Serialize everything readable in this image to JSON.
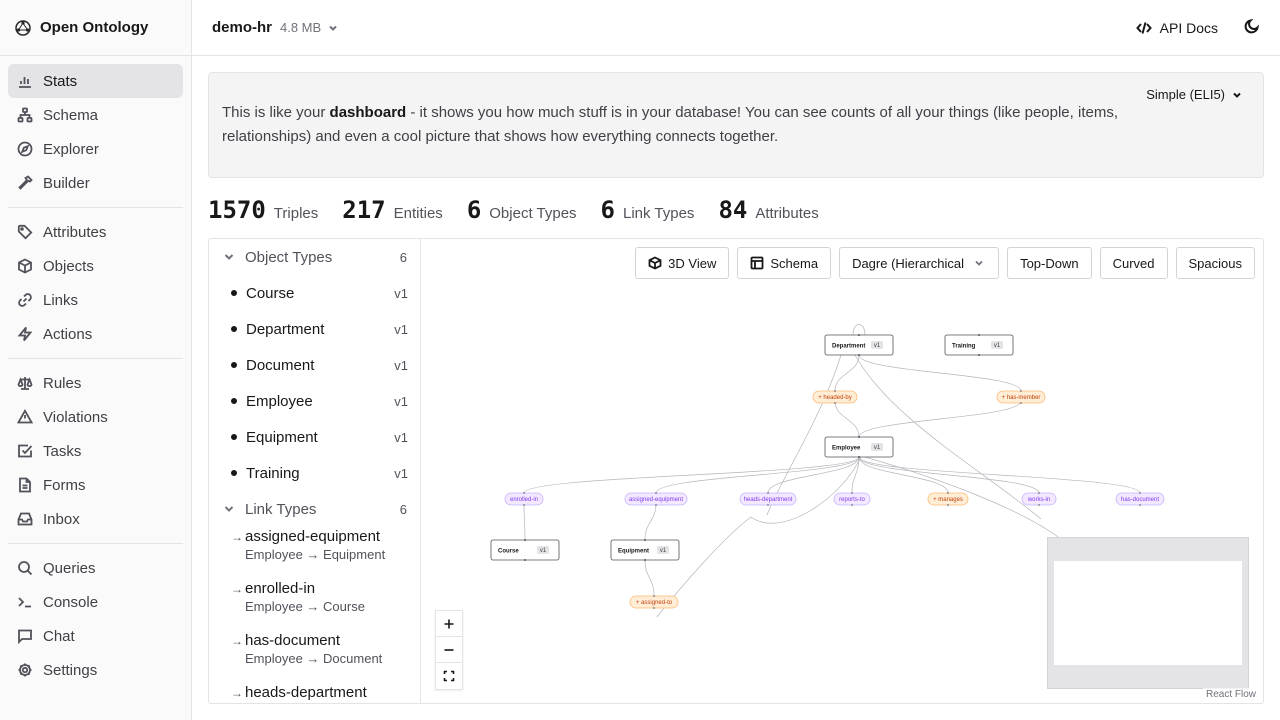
{
  "app": {
    "title": "Open Ontology"
  },
  "sidebar": {
    "groups": [
      [
        {
          "label": "Stats",
          "icon": "bar-chart-icon",
          "active": true
        },
        {
          "label": "Schema",
          "icon": "network-icon"
        },
        {
          "label": "Explorer",
          "icon": "compass-icon"
        },
        {
          "label": "Builder",
          "icon": "hammer-icon"
        }
      ],
      [
        {
          "label": "Attributes",
          "icon": "tag-icon"
        },
        {
          "label": "Objects",
          "icon": "box-icon"
        },
        {
          "label": "Links",
          "icon": "link-icon"
        },
        {
          "label": "Actions",
          "icon": "zap-icon"
        }
      ],
      [
        {
          "label": "Rules",
          "icon": "scale-icon"
        },
        {
          "label": "Violations",
          "icon": "alert-triangle-icon"
        },
        {
          "label": "Tasks",
          "icon": "check-square-icon"
        },
        {
          "label": "Forms",
          "icon": "file-text-icon"
        },
        {
          "label": "Inbox",
          "icon": "inbox-icon"
        }
      ],
      [
        {
          "label": "Queries",
          "icon": "search-icon"
        },
        {
          "label": "Console",
          "icon": "terminal-icon"
        },
        {
          "label": "Chat",
          "icon": "message-square-icon"
        },
        {
          "label": "Settings",
          "icon": "gear-icon"
        }
      ]
    ]
  },
  "header": {
    "db_name": "demo-hr",
    "db_size": "4.8 MB",
    "api_docs": "API Docs"
  },
  "info": {
    "text_before": "This is like your ",
    "text_bold": "dashboard",
    "text_after": " - it shows you how much stuff is in your database! You can see counts of all your things (like people, items, relationships) and even a cool picture that shows how everything connects together.",
    "mode": "Simple (ELI5)"
  },
  "stats": [
    {
      "value": "1570",
      "label": "Triples"
    },
    {
      "value": "217",
      "label": "Entities"
    },
    {
      "value": "6",
      "label": "Object Types"
    },
    {
      "value": "6",
      "label": "Link Types"
    },
    {
      "value": "84",
      "label": "Attributes"
    }
  ],
  "object_types": {
    "heading": "Object Types",
    "count": "6",
    "items": [
      {
        "name": "Course",
        "version": "v1"
      },
      {
        "name": "Department",
        "version": "v1"
      },
      {
        "name": "Document",
        "version": "v1"
      },
      {
        "name": "Employee",
        "version": "v1"
      },
      {
        "name": "Equipment",
        "version": "v1"
      },
      {
        "name": "Training",
        "version": "v1"
      }
    ]
  },
  "link_types": {
    "heading": "Link Types",
    "count": "6",
    "items": [
      {
        "name": "assigned-equipment",
        "route": "Employee → Equipment"
      },
      {
        "name": "enrolled-in",
        "route": "Employee → Course"
      },
      {
        "name": "has-document",
        "route": "Employee → Document"
      },
      {
        "name": "heads-department",
        "route": ""
      }
    ]
  },
  "toolbar": {
    "view3d": "3D View",
    "schema": "Schema",
    "layout": "Dagre (Hierarchical",
    "direction": "Top-Down",
    "edges": "Curved",
    "spacing": "Spacious"
  },
  "graph": {
    "nodes": [
      {
        "id": "dept",
        "label": "Department",
        "version": "v1"
      },
      {
        "id": "train",
        "label": "Training",
        "version": "v1"
      },
      {
        "id": "emp",
        "label": "Employee",
        "version": "v1"
      },
      {
        "id": "course",
        "label": "Course",
        "version": "v1"
      },
      {
        "id": "equip",
        "label": "Equipment",
        "version": "v1"
      }
    ],
    "links": [
      {
        "id": "headed-by",
        "label": "+ headed-by",
        "kind": "action"
      },
      {
        "id": "has-member",
        "label": "+ has-member",
        "kind": "action"
      },
      {
        "id": "enrolled-in",
        "label": "enrolled-in",
        "kind": "link"
      },
      {
        "id": "assigned-equipment",
        "label": "assigned-equipment",
        "kind": "link"
      },
      {
        "id": "heads-department",
        "label": "heads-department",
        "kind": "link"
      },
      {
        "id": "reports-to",
        "label": "reports-to",
        "kind": "link"
      },
      {
        "id": "manages",
        "label": "+ manages",
        "kind": "action"
      },
      {
        "id": "works-in",
        "label": "works-in",
        "kind": "link"
      },
      {
        "id": "has-document",
        "label": "has-document",
        "kind": "link"
      },
      {
        "id": "assigned-to",
        "label": "+ assigned-to",
        "kind": "action"
      }
    ],
    "colors": {
      "link_fill": "#f3e8ff",
      "link_stroke": "#c4b5fd",
      "link_text": "#7c3aed",
      "action_fill": "#ffedd5",
      "action_stroke": "#fdba74",
      "action_text": "#c2410c"
    }
  },
  "attribution": "React Flow"
}
